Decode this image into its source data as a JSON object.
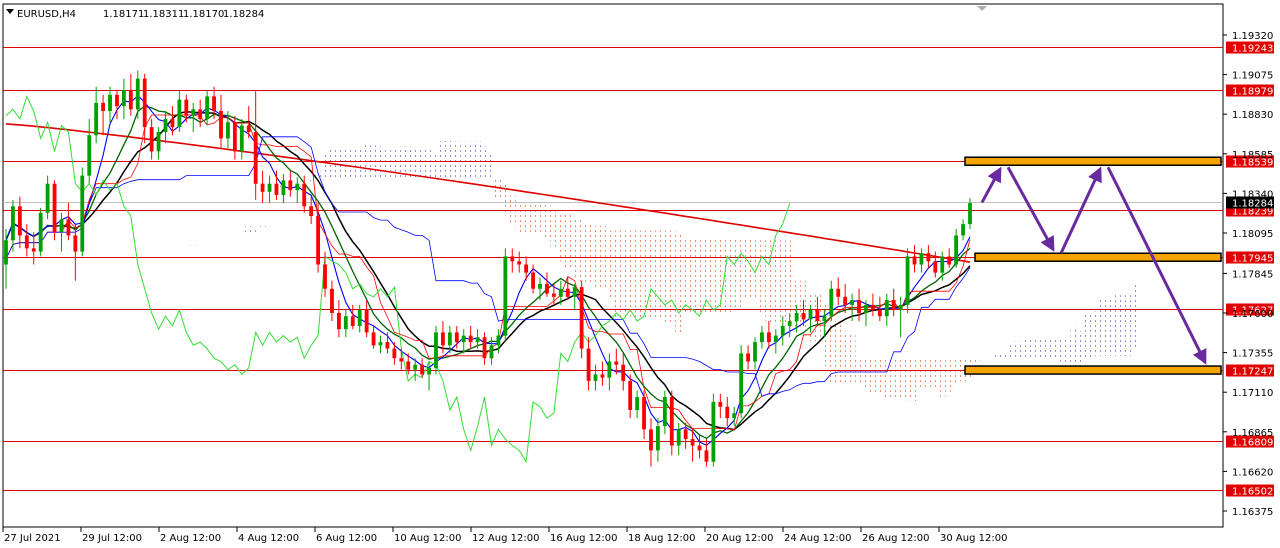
{
  "header": {
    "symbol": "EURUSD,H4",
    "open": "1.18171",
    "high": "1.18311",
    "low": "1.18170",
    "close": "1.18284"
  },
  "colors": {
    "bull": "#00a000",
    "bear": "#ff0000",
    "level": "#e00000",
    "ma_fast": "#0000ff",
    "ma_mid": "#006400",
    "ma_slow": "#000000",
    "ma_long": "#e00000",
    "chikou": "#33dd33",
    "zone": "#f5a500",
    "arrow": "#6a2a9f"
  },
  "chart_data": {
    "type": "candlestick",
    "symbol": "EURUSD",
    "timeframe": "H4",
    "ylim": [
      1.1625,
      1.194
    ],
    "x_ticks": [
      "27 Jul 2021",
      "29 Jul 12:00",
      "2 Aug 12:00",
      "4 Aug 12:00",
      "6 Aug 12:00",
      "10 Aug 12:00",
      "12 Aug 12:00",
      "16 Aug 12:00",
      "18 Aug 12:00",
      "20 Aug 12:00",
      "24 Aug 12:00",
      "26 Aug 12:00",
      "30 Aug 12:00"
    ],
    "y_ticks": [
      "1.19320",
      "1.19075",
      "1.18830",
      "1.18585",
      "1.18340",
      "1.18095",
      "1.17845",
      "1.17600",
      "1.17355",
      "1.17110",
      "1.16865",
      "1.16620",
      "1.16375"
    ],
    "current_price": "1.18284",
    "levels": [
      "1.19243",
      "1.18979",
      "1.18539",
      "1.18239",
      "1.17945",
      "1.17627",
      "1.17247",
      "1.16809",
      "1.16502"
    ],
    "zones": [
      "1.18539",
      "1.17945",
      "1.17247"
    ],
    "projection": [
      "1.18284",
      "1.18539",
      "1.17945",
      "1.18539",
      "1.17247"
    ],
    "candles": [
      [
        1.179,
        1.1812,
        1.1775,
        1.1805
      ],
      [
        1.1805,
        1.183,
        1.1798,
        1.1826
      ],
      [
        1.1826,
        1.1832,
        1.18,
        1.1808
      ],
      [
        1.1808,
        1.1815,
        1.1795,
        1.18
      ],
      [
        1.18,
        1.181,
        1.179,
        1.1798
      ],
      [
        1.1798,
        1.1825,
        1.1795,
        1.1822
      ],
      [
        1.1822,
        1.1845,
        1.1818,
        1.184
      ],
      [
        1.184,
        1.1842,
        1.1805,
        1.181
      ],
      [
        1.181,
        1.1822,
        1.1798,
        1.1818
      ],
      [
        1.1818,
        1.1828,
        1.1805,
        1.1808
      ],
      [
        1.1808,
        1.1815,
        1.178,
        1.1798
      ],
      [
        1.1798,
        1.185,
        1.1795,
        1.1845
      ],
      [
        1.1845,
        1.188,
        1.184,
        1.187
      ],
      [
        1.187,
        1.19,
        1.1865,
        1.189
      ],
      [
        1.189,
        1.1895,
        1.187,
        1.1885
      ],
      [
        1.1885,
        1.19,
        1.1878,
        1.1895
      ],
      [
        1.1895,
        1.1898,
        1.188,
        1.1888
      ],
      [
        1.1888,
        1.1905,
        1.188,
        1.1898
      ],
      [
        1.1898,
        1.1908,
        1.1882,
        1.1886
      ],
      [
        1.1886,
        1.191,
        1.188,
        1.1905
      ],
      [
        1.1905,
        1.1908,
        1.1865,
        1.1875
      ],
      [
        1.1875,
        1.188,
        1.1855,
        1.186
      ],
      [
        1.186,
        1.1875,
        1.1855,
        1.1872
      ],
      [
        1.1872,
        1.1885,
        1.1865,
        1.188
      ],
      [
        1.188,
        1.1888,
        1.187,
        1.1875
      ],
      [
        1.1875,
        1.1898,
        1.1872,
        1.1892
      ],
      [
        1.1892,
        1.1895,
        1.1878,
        1.1882
      ],
      [
        1.1882,
        1.189,
        1.1872,
        1.1886
      ],
      [
        1.1886,
        1.1892,
        1.1875,
        1.188
      ],
      [
        1.188,
        1.1898,
        1.1876,
        1.1894
      ],
      [
        1.1894,
        1.19,
        1.188,
        1.1885
      ],
      [
        1.1885,
        1.1895,
        1.1862,
        1.1868
      ],
      [
        1.1868,
        1.1885,
        1.1862,
        1.1878
      ],
      [
        1.1878,
        1.1882,
        1.1855,
        1.186
      ],
      [
        1.186,
        1.188,
        1.1855,
        1.1876
      ],
      [
        1.1876,
        1.1888,
        1.1868,
        1.1872
      ],
      [
        1.1872,
        1.1898,
        1.183,
        1.184
      ],
      [
        1.184,
        1.1848,
        1.1828,
        1.1835
      ],
      [
        1.1835,
        1.1845,
        1.1828,
        1.184
      ],
      [
        1.184,
        1.1848,
        1.183,
        1.1833
      ],
      [
        1.1833,
        1.1846,
        1.1828,
        1.1842
      ],
      [
        1.1842,
        1.1848,
        1.1832,
        1.1836
      ],
      [
        1.1836,
        1.1844,
        1.1828,
        1.184
      ],
      [
        1.184,
        1.1845,
        1.1822,
        1.1826
      ],
      [
        1.1826,
        1.1832,
        1.1815,
        1.182
      ],
      [
        1.182,
        1.1828,
        1.1785,
        1.179
      ],
      [
        1.179,
        1.1798,
        1.177,
        1.1775
      ],
      [
        1.1775,
        1.178,
        1.1755,
        1.176
      ],
      [
        1.176,
        1.1768,
        1.1745,
        1.175
      ],
      [
        1.175,
        1.1762,
        1.1745,
        1.1758
      ],
      [
        1.1758,
        1.1765,
        1.175,
        1.1752
      ],
      [
        1.1752,
        1.1765,
        1.1748,
        1.1762
      ],
      [
        1.1762,
        1.1768,
        1.1745,
        1.1748
      ],
      [
        1.1748,
        1.1752,
        1.1738,
        1.174
      ],
      [
        1.174,
        1.1746,
        1.1735,
        1.1742
      ],
      [
        1.1742,
        1.1748,
        1.1735,
        1.1738
      ],
      [
        1.1738,
        1.1742,
        1.1728,
        1.1732
      ],
      [
        1.1732,
        1.1738,
        1.1725,
        1.173
      ],
      [
        1.173,
        1.1735,
        1.1722,
        1.1725
      ],
      [
        1.1725,
        1.1732,
        1.1718,
        1.1728
      ],
      [
        1.1728,
        1.1732,
        1.172,
        1.1722
      ],
      [
        1.1722,
        1.173,
        1.1712,
        1.1726
      ],
      [
        1.1726,
        1.1752,
        1.1722,
        1.1748
      ],
      [
        1.1748,
        1.1755,
        1.1735,
        1.174
      ],
      [
        1.174,
        1.1752,
        1.1735,
        1.1748
      ],
      [
        1.1748,
        1.1752,
        1.1738,
        1.1742
      ],
      [
        1.1742,
        1.175,
        1.1735,
        1.1746
      ],
      [
        1.1746,
        1.1752,
        1.1738,
        1.1742
      ],
      [
        1.1742,
        1.175,
        1.1738,
        1.1745
      ],
      [
        1.1745,
        1.1748,
        1.1728,
        1.1732
      ],
      [
        1.1732,
        1.1745,
        1.1728,
        1.174
      ],
      [
        1.174,
        1.175,
        1.1735,
        1.1746
      ],
      [
        1.1746,
        1.18,
        1.1742,
        1.1795
      ],
      [
        1.1795,
        1.18,
        1.1785,
        1.1792
      ],
      [
        1.1792,
        1.1798,
        1.1785,
        1.179
      ],
      [
        1.179,
        1.1795,
        1.178,
        1.1785
      ],
      [
        1.1785,
        1.179,
        1.1772,
        1.1775
      ],
      [
        1.1775,
        1.1782,
        1.1768,
        1.1778
      ],
      [
        1.1778,
        1.1785,
        1.177,
        1.1772
      ],
      [
        1.1772,
        1.1778,
        1.1765,
        1.177
      ],
      [
        1.177,
        1.178,
        1.1765,
        1.1775
      ],
      [
        1.1775,
        1.1782,
        1.1768,
        1.177
      ],
      [
        1.177,
        1.1778,
        1.1762,
        1.1776
      ],
      [
        1.1776,
        1.178,
        1.1732,
        1.1738
      ],
      [
        1.1738,
        1.1745,
        1.1712,
        1.1718
      ],
      [
        1.1718,
        1.1728,
        1.1712,
        1.1722
      ],
      [
        1.1722,
        1.173,
        1.1715,
        1.172
      ],
      [
        1.172,
        1.1735,
        1.1712,
        1.173
      ],
      [
        1.173,
        1.1738,
        1.1722,
        1.1728
      ],
      [
        1.1728,
        1.1735,
        1.1712,
        1.1718
      ],
      [
        1.1718,
        1.1722,
        1.1695,
        1.17
      ],
      [
        1.17,
        1.1712,
        1.1695,
        1.1708
      ],
      [
        1.1708,
        1.1712,
        1.1682,
        1.1688
      ],
      [
        1.1688,
        1.1695,
        1.1665,
        1.1675
      ],
      [
        1.1675,
        1.1695,
        1.1668,
        1.169
      ],
      [
        1.169,
        1.1712,
        1.1685,
        1.1708
      ],
      [
        1.1708,
        1.1712,
        1.1672,
        1.1678
      ],
      [
        1.1678,
        1.1692,
        1.1672,
        1.1688
      ],
      [
        1.1688,
        1.1692,
        1.1676,
        1.1682
      ],
      [
        1.1682,
        1.1688,
        1.1668,
        1.1678
      ],
      [
        1.1678,
        1.1685,
        1.167,
        1.1675
      ],
      [
        1.1675,
        1.1682,
        1.1665,
        1.1668
      ],
      [
        1.1668,
        1.171,
        1.1665,
        1.1705
      ],
      [
        1.1705,
        1.171,
        1.1695,
        1.1702
      ],
      [
        1.1702,
        1.1708,
        1.169,
        1.1695
      ],
      [
        1.1695,
        1.1702,
        1.169,
        1.1698
      ],
      [
        1.1698,
        1.174,
        1.1695,
        1.1735
      ],
      [
        1.1735,
        1.174,
        1.1725,
        1.173
      ],
      [
        1.173,
        1.1745,
        1.1725,
        1.1742
      ],
      [
        1.1742,
        1.1752,
        1.1738,
        1.1748
      ],
      [
        1.1748,
        1.1755,
        1.1738,
        1.1742
      ],
      [
        1.1742,
        1.175,
        1.1735,
        1.1746
      ],
      [
        1.1746,
        1.1758,
        1.174,
        1.1752
      ],
      [
        1.1752,
        1.176,
        1.1745,
        1.1755
      ],
      [
        1.1755,
        1.1765,
        1.1748,
        1.176
      ],
      [
        1.176,
        1.1768,
        1.1752,
        1.1756
      ],
      [
        1.1756,
        1.1765,
        1.1748,
        1.1762
      ],
      [
        1.1762,
        1.177,
        1.1752,
        1.1755
      ],
      [
        1.1755,
        1.1762,
        1.1745,
        1.1758
      ],
      [
        1.1758,
        1.178,
        1.1755,
        1.1775
      ],
      [
        1.1775,
        1.1782,
        1.1765,
        1.177
      ],
      [
        1.177,
        1.1778,
        1.176,
        1.1765
      ],
      [
        1.1765,
        1.1772,
        1.1755,
        1.1768
      ],
      [
        1.1768,
        1.1775,
        1.1755,
        1.176
      ],
      [
        1.176,
        1.1768,
        1.1752,
        1.1765
      ],
      [
        1.1765,
        1.1772,
        1.1758,
        1.1762
      ],
      [
        1.1762,
        1.177,
        1.1755,
        1.1758
      ],
      [
        1.1758,
        1.1772,
        1.1752,
        1.1768
      ],
      [
        1.1768,
        1.1775,
        1.1758,
        1.1762
      ],
      [
        1.1762,
        1.177,
        1.1745,
        1.1765
      ],
      [
        1.1765,
        1.18,
        1.176,
        1.1795
      ],
      [
        1.1795,
        1.1802,
        1.1785,
        1.179
      ],
      [
        1.179,
        1.18,
        1.1785,
        1.1797
      ],
      [
        1.1797,
        1.1802,
        1.1788,
        1.1792
      ],
      [
        1.1792,
        1.1798,
        1.1782,
        1.1785
      ],
      [
        1.1785,
        1.1798,
        1.178,
        1.1795
      ],
      [
        1.1795,
        1.18,
        1.1788,
        1.179
      ],
      [
        1.179,
        1.1812,
        1.1788,
        1.1808
      ],
      [
        1.1808,
        1.1818,
        1.1805,
        1.1815
      ],
      [
        1.1815,
        1.1831,
        1.1812,
        1.1828
      ]
    ]
  }
}
